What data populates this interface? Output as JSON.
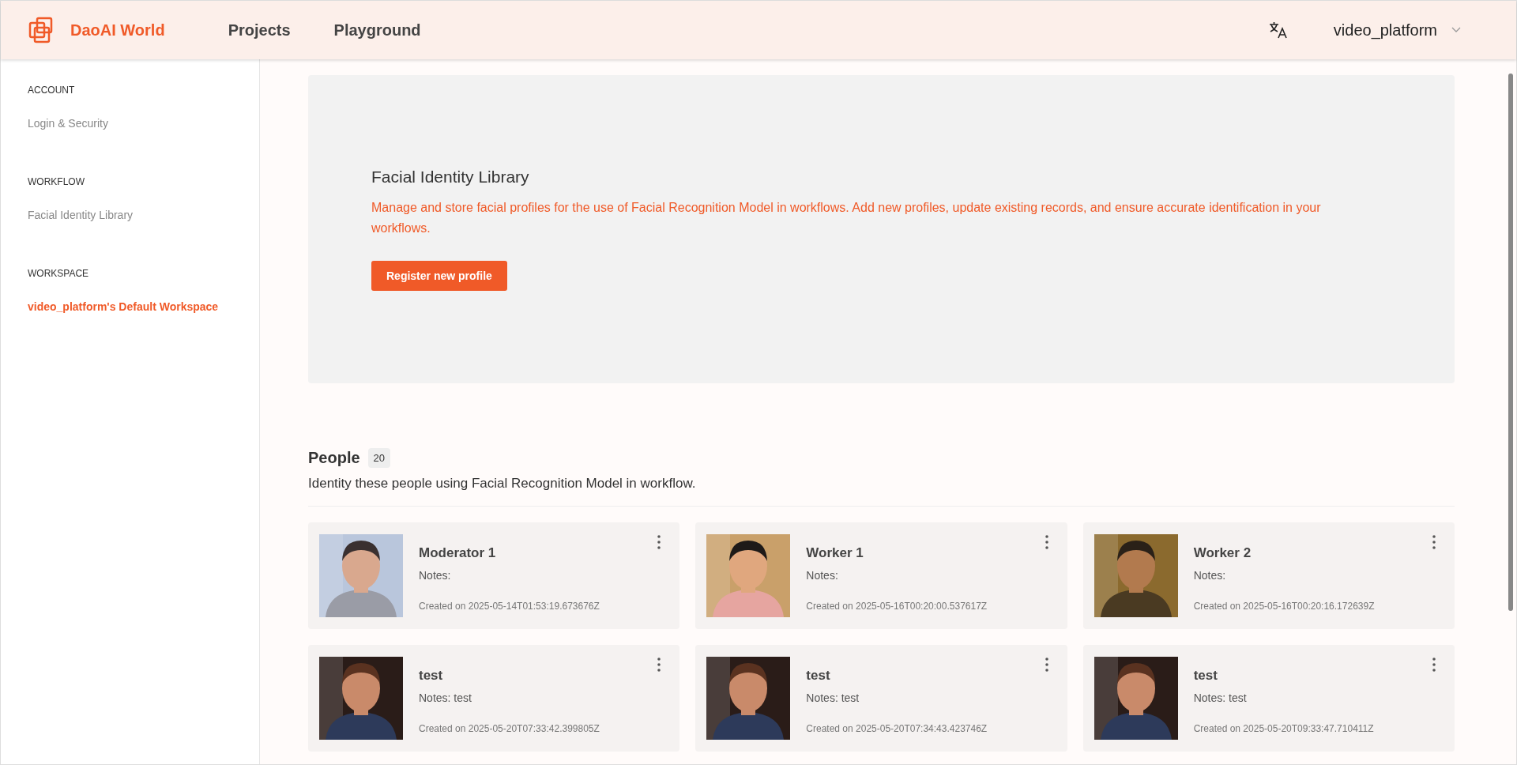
{
  "header": {
    "brand": "DaoAI World",
    "nav": [
      "Projects",
      "Playground"
    ],
    "user": "video_platform"
  },
  "sidebar": {
    "sections": [
      {
        "heading": "ACCOUNT",
        "items": [
          {
            "label": "Login & Security",
            "selected": false
          }
        ]
      },
      {
        "heading": "WORKFLOW",
        "items": [
          {
            "label": "Facial Identity Library",
            "selected": false
          }
        ]
      },
      {
        "heading": "WORKSPACE",
        "items": [
          {
            "label": "video_platform's Default Workspace",
            "selected": true
          }
        ]
      }
    ]
  },
  "hero": {
    "title": "Facial Identity Library",
    "description": "Manage and store facial profiles for the use of Facial Recognition Model in workflows. Add new profiles, update existing records, and ensure accurate identification in your workflows.",
    "button": "Register new profile"
  },
  "people": {
    "title": "People",
    "count": "20",
    "subtitle": "Identity these people using Facial Recognition Model in workflow.",
    "cards": [
      {
        "name": "Moderator 1",
        "notes": "Notes:",
        "created": "Created on 2025-05-14T01:53:19.673676Z"
      },
      {
        "name": "Worker 1",
        "notes": "Notes:",
        "created": "Created on 2025-05-16T00:20:00.537617Z"
      },
      {
        "name": "Worker 2",
        "notes": "Notes:",
        "created": "Created on 2025-05-16T00:20:16.172639Z"
      },
      {
        "name": "test",
        "notes": "Notes: test",
        "created": "Created on 2025-05-20T07:33:42.399805Z"
      },
      {
        "name": "test",
        "notes": "Notes: test",
        "created": "Created on 2025-05-20T07:34:43.423746Z"
      },
      {
        "name": "test",
        "notes": "Notes: test",
        "created": "Created on 2025-05-20T09:33:47.710411Z"
      }
    ]
  }
}
